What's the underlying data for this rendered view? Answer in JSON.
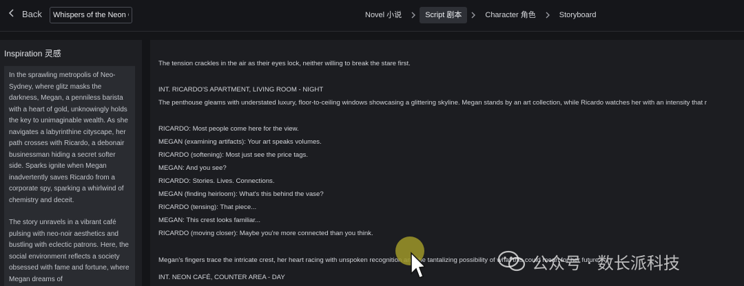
{
  "header": {
    "back_label": "Back",
    "project_title": "Whispers of the Neon Ca",
    "steps": [
      {
        "label": "Novel  小说"
      },
      {
        "label": "Script  剧本"
      },
      {
        "label": "Character  角色"
      },
      {
        "label": "Storyboard"
      }
    ]
  },
  "inspiration": {
    "title": "Inspiration    灵感",
    "paragraphs": [
      "In the sprawling metropolis of Neo-Sydney, where glitz masks the darkness, Megan, a penniless barista with a heart of gold, unknowingly holds the key to unimaginable wealth. As she navigates a labyrinthine cityscape, her path crosses with Ricardo, a debonair businessman hiding a secret softer side. Sparks ignite when Megan inadvertently saves Ricardo from a corporate spy, sparking a whirlwind of chemistry and deceit.",
      "The story unravels in a vibrant café pulsing with neo-noir aesthetics and bustling with eclectic patrons. Here, the social environment reflects a society obsessed with fame and fortune, where Megan dreams of"
    ]
  },
  "script": {
    "lines": [
      "The tension crackles in the air as their eyes lock, neither willing to break the stare first.",
      "INT. RICARDO'S APARTMENT, LIVING ROOM - NIGHT",
      "The penthouse gleams with understated luxury, floor-to-ceiling windows showcasing a glittering skyline. Megan stands by an art collection, while Ricardo watches her with an intensity that r",
      "RICARDO: Most people come here for the view.",
      "MEGAN (examining artifacts): Your art speaks volumes.",
      "RICARDO (softening): Most just see the price tags.",
      "MEGAN: And you see?",
      "RICARDO: Stories. Lives. Connections.",
      "MEGAN (finding heirloom): What's this behind the vase?",
      "RICARDO (tensing): That piece...",
      "MEGAN: This crest looks familiar...",
      "RICARDO (moving closer): Maybe you're more connected than you think.",
      "Megan's fingers trace the intricate crest, her heart racing with unspoken recognition and the tantalizing possibility of what this could mean for her future.",
      "INT. NEON CAFÉ, COUNTER AREA - DAY"
    ]
  },
  "watermark": {
    "text": "公众号 · 数长派科技"
  }
}
